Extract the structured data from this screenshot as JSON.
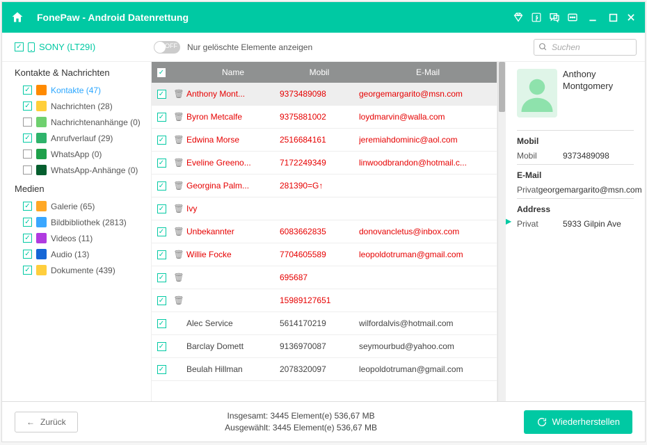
{
  "titlebar": {
    "title": "FonePaw - Android Datenrettung"
  },
  "device": {
    "name": "SONY (LT29I)"
  },
  "toggle": {
    "off": "OFF",
    "label": "Nur gelöschte Elemente anzeigen"
  },
  "search": {
    "placeholder": "Suchen"
  },
  "sidebar": {
    "section1": "Kontakte & Nachrichten",
    "section2": "Medien",
    "items1": [
      {
        "label": "Kontakte (47)",
        "active": true,
        "checked": true,
        "color": "#ff8a00"
      },
      {
        "label": "Nachrichten (28)",
        "active": false,
        "checked": true,
        "color": "#ffcf3a"
      },
      {
        "label": "Nachrichtenanhänge (0)",
        "active": false,
        "checked": false,
        "color": "#6fd06f"
      },
      {
        "label": "Anrufverlauf (29)",
        "active": false,
        "checked": true,
        "color": "#2fb36b"
      },
      {
        "label": "WhatsApp (0)",
        "active": false,
        "checked": false,
        "color": "#1ea04a"
      },
      {
        "label": "WhatsApp-Anhänge (0)",
        "active": false,
        "checked": false,
        "color": "#055e2e"
      }
    ],
    "items2": [
      {
        "label": "Galerie (65)",
        "checked": true,
        "color": "#ffa826"
      },
      {
        "label": "Bildbibliothek (2813)",
        "checked": true,
        "color": "#3aa7ff"
      },
      {
        "label": "Videos (11)",
        "checked": true,
        "color": "#b03be0"
      },
      {
        "label": "Audio (13)",
        "checked": true,
        "color": "#1566d6"
      },
      {
        "label": "Dokumente (439)",
        "checked": true,
        "color": "#ffce3d"
      }
    ]
  },
  "table": {
    "head": {
      "name": "Name",
      "mobil": "Mobil",
      "email": "E-Mail"
    },
    "rows": [
      {
        "deleted": true,
        "selected": true,
        "name": "Anthony Mont...",
        "mobil": "9373489098",
        "email": "georgemargarito@msn.com"
      },
      {
        "deleted": true,
        "name": "Byron Metcalfe",
        "mobil": "9375881002",
        "email": "loydmarvin@walla.com"
      },
      {
        "deleted": true,
        "name": "Edwina Morse",
        "mobil": "2516684161",
        "email": "jeremiahdominic@aol.com"
      },
      {
        "deleted": true,
        "name": "Eveline Greeno...",
        "mobil": "7172249349",
        "email": "linwoodbrandon@hotmail.c..."
      },
      {
        "deleted": true,
        "name": "Georgina Palm...",
        "mobil": "281390=G↑",
        "email": ""
      },
      {
        "deleted": true,
        "name": "Ivy",
        "mobil": "",
        "email": ""
      },
      {
        "deleted": true,
        "name": "Unbekannter",
        "mobil": "6083662835",
        "email": "donovancletus@inbox.com"
      },
      {
        "deleted": true,
        "name": "Willie Focke",
        "mobil": "7704605589",
        "email": "leopoldotruman@gmail.com"
      },
      {
        "deleted": true,
        "name": "",
        "mobil": "695687",
        "email": ""
      },
      {
        "deleted": true,
        "name": "",
        "mobil": "15989127651",
        "email": ""
      },
      {
        "deleted": false,
        "name": "Alec Service",
        "mobil": "5614170219",
        "email": "wilfordalvis@hotmail.com"
      },
      {
        "deleted": false,
        "name": "Barclay Domett",
        "mobil": "9136970087",
        "email": "seymourbud@yahoo.com"
      },
      {
        "deleted": false,
        "name": "Beulah Hillman",
        "mobil": "2078320097",
        "email": "leopoldotruman@gmail.com"
      }
    ]
  },
  "detail": {
    "name": "Anthony Montgomery",
    "mobil_head": "Mobil",
    "mobil_k": "Mobil",
    "mobil_v": "9373489098",
    "email_head": "E-Mail",
    "email_k": "Privat",
    "email_v": "georgemargarito@msn.com",
    "addr_head": "Address",
    "addr_k": "Privat",
    "addr_v": "5933 Gilpin Ave"
  },
  "footer": {
    "back": "Zurück",
    "total": "Insgesamt: 3445 Element(e) 536,67 MB",
    "selected": "Ausgewählt: 3445 Element(e) 536,67 MB",
    "recover": "Wiederherstellen"
  }
}
